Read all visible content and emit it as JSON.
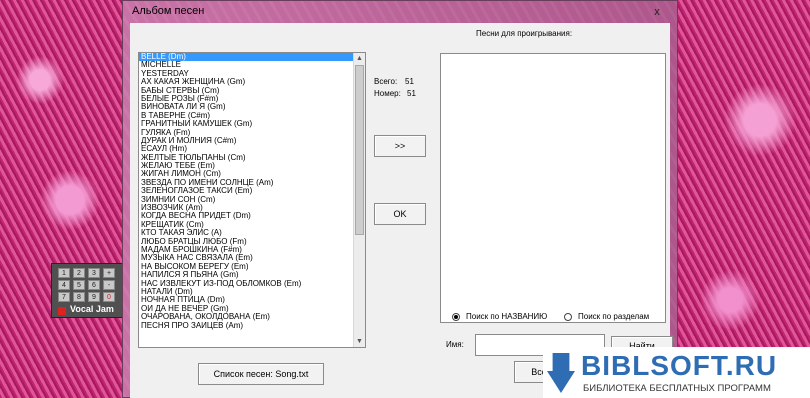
{
  "window": {
    "title": "Альбом песен",
    "close_label": "x"
  },
  "songs": {
    "items": [
      "BELLE (Dm)",
      "MICHELLE",
      "YESTERDAY",
      "АХ КАКАЯ ЖЕНЩИНА (Gm)",
      "БАБЫ СТЕРВЫ (Cm)",
      "БЕЛЫЕ РОЗЫ (F#m)",
      "ВИНОВАТА ЛИ Я (Gm)",
      "В ТАВЕРНЕ (C#m)",
      "ГРАНИТНЫЙ КАМУШЕК (Gm)",
      "ГУЛЯКА (Fm)",
      "ДУРАК И МОЛНИЯ (C#m)",
      "ЕСАУЛ (Hm)",
      "ЖЁЛТЫЕ ТЮЛЬПАНЫ (Cm)",
      "ЖЕЛАЮ ТЕБЕ (Em)",
      "ЖИГАН ЛИМОН (Cm)",
      "ЗВЕЗДА ПО ИМЕНИ СОЛНЦЕ (Am)",
      "ЗЕЛЕНОГЛАЗОЕ ТАКСИ (Em)",
      "ЗИМНИЙ СОН (Cm)",
      "ИЗВОЗЧИК (Am)",
      "КОГДА ВЕСНА ПРИДЁТ (Dm)",
      "КРЕЩАТИК (Cm)",
      "КТО ТАКАЯ ЭЛИС (A)",
      "ЛЮБО БРАТЦЫ ЛЮБО (Fm)",
      "МАДАМ БРОШКИНА (F#m)",
      "МУЗЫКА НАС СВЯЗАЛА (Em)",
      "НА ВЫСОКОМ БЕРЕГУ (Em)",
      "НАПИЛСЯ Я ПЬЯНА (Gm)",
      "НАС ИЗВЛЕКУТ ИЗ-ПОД ОБЛОМКОВ (Em)",
      "НАТАЛИ (Dm)",
      "НОЧНАЯ ПТИЦА (Dm)",
      "ОЙ ДА НЕ ВЕЧЕР (Gm)",
      "ОЧАРОВАНА, ОКОЛДОВАНА (Em)",
      "ПЕСНЯ ПРО ЗАЙЦЕВ (Am)"
    ],
    "selected_index": 0
  },
  "stats": {
    "total_label": "Всего:",
    "total_value": "51",
    "number_label": "Номер:",
    "number_value": "51"
  },
  "buttons": {
    "add": ">>",
    "ok": "OK",
    "song_list": "Список песен: Song.txt",
    "find": "Найти",
    "all": "Все"
  },
  "playlist": {
    "label": "Песни для проигрывания:"
  },
  "search": {
    "by_name": "Поиск по НАЗВАНИЮ",
    "by_section": "Поиск по разделам",
    "name_label": "Имя:",
    "name_value": ""
  },
  "calculator": {
    "keys": [
      "1",
      "2",
      "3",
      "+",
      "4",
      "5",
      "6",
      "-",
      "7",
      "8",
      "9",
      "0"
    ],
    "logo": "Vocal Jam"
  },
  "watermark": {
    "title": "BIBLSOFT.RU",
    "subtitle": "БИБЛИОТЕКА БЕСПЛАТНЫХ ПРОГРАММ"
  }
}
